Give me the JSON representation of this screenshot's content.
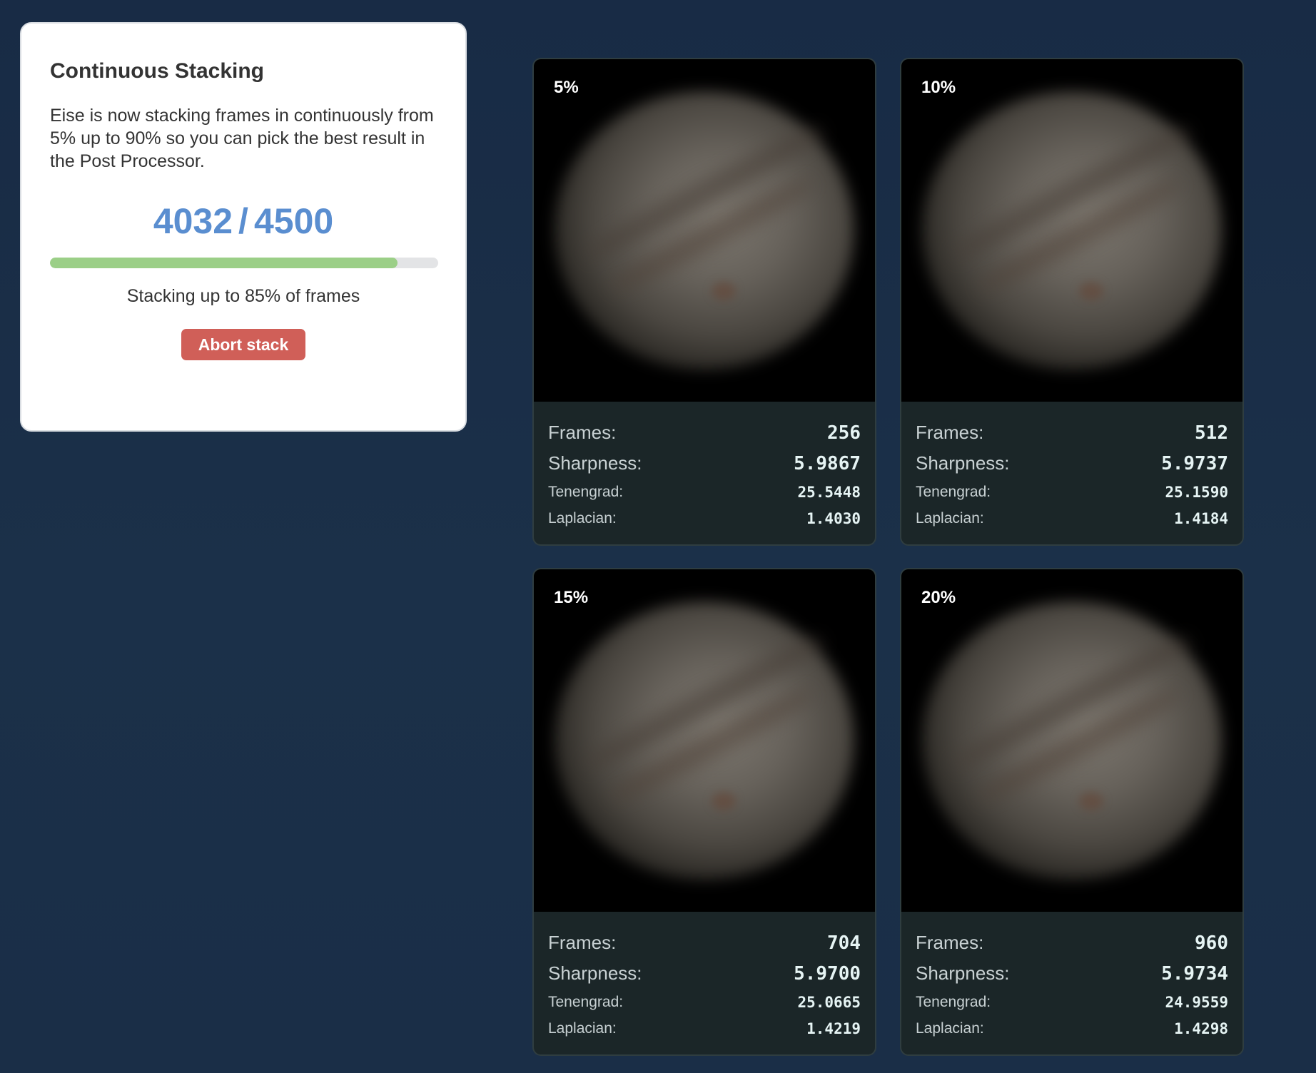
{
  "panel": {
    "title": "Continuous Stacking",
    "description": "Eise is now stacking frames in continuously from 5% up to 90% so you can pick the best result in the Post Processor.",
    "progress": {
      "current": "4032",
      "separator": "/",
      "total": "4500",
      "fraction": 0.896
    },
    "status": "Stacking up to 85% of frames",
    "abort_label": "Abort stack"
  },
  "labels": {
    "frames": "Frames:",
    "sharpness": "Sharpness:",
    "tenengrad": "Tenengrad:",
    "laplacian": "Laplacian:"
  },
  "colors": {
    "accent_blue": "#5a8ed0",
    "progress_green": "#9bcf87",
    "abort_red": "#d05f58",
    "card_bg": "#1b2628"
  },
  "cards": [
    {
      "percent": "5%",
      "frames": "256",
      "sharpness": "5.9867",
      "tenengrad": "25.5448",
      "laplacian": "1.4030"
    },
    {
      "percent": "10%",
      "frames": "512",
      "sharpness": "5.9737",
      "tenengrad": "25.1590",
      "laplacian": "1.4184"
    },
    {
      "percent": "15%",
      "frames": "704",
      "sharpness": "5.9700",
      "tenengrad": "25.0665",
      "laplacian": "1.4219"
    },
    {
      "percent": "20%",
      "frames": "960",
      "sharpness": "5.9734",
      "tenengrad": "24.9559",
      "laplacian": "1.4298"
    }
  ]
}
